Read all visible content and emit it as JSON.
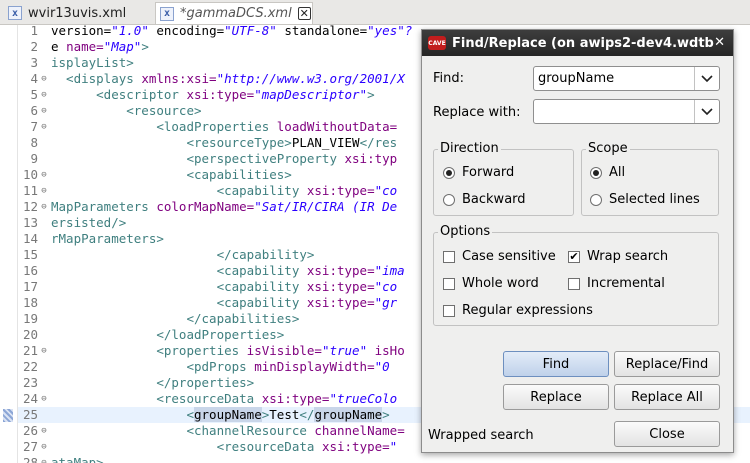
{
  "tabs": [
    {
      "icon": "x",
      "name": "wvir13uvis.xml",
      "dirty": false
    },
    {
      "icon": "x",
      "name": "*gammaDCS.xml",
      "dirty": true,
      "close": "☒"
    }
  ],
  "editor": {
    "lines": [
      {
        "num": "1",
        "fold": "",
        "parts": [
          [
            "tx",
            "version="
          ],
          [
            "av",
            "\"1.0\""
          ],
          [
            "tx",
            " encoding="
          ],
          [
            "av",
            "\"UTF-8\""
          ],
          [
            "tx",
            " standalone="
          ],
          [
            "av",
            "\"yes\"?"
          ]
        ]
      },
      {
        "num": "2",
        "fold": "",
        "parts": [
          [
            "tx",
            "e "
          ],
          [
            "at",
            "name="
          ],
          [
            "av",
            "\"Map\""
          ],
          [
            "tg",
            ">"
          ]
        ]
      },
      {
        "num": "3",
        "fold": "",
        "parts": [
          [
            "tg",
            "isplayList>"
          ]
        ]
      },
      {
        "num": "4",
        "fold": "⊖",
        "parts": [
          [
            "tg",
            "  <displays "
          ],
          [
            "at",
            "xmlns:xsi="
          ],
          [
            "av",
            "\"http://www.w3.org/2001/X"
          ]
        ]
      },
      {
        "num": "5",
        "fold": "⊖",
        "parts": [
          [
            "tg",
            "      <descriptor "
          ],
          [
            "at",
            "xsi:type="
          ],
          [
            "av",
            "\"mapDescriptor\""
          ],
          [
            "tg",
            ">"
          ]
        ]
      },
      {
        "num": "6",
        "fold": "⊖",
        "parts": [
          [
            "tg",
            "          <resource>"
          ]
        ]
      },
      {
        "num": "7",
        "fold": "⊖",
        "parts": [
          [
            "tg",
            "              <loadProperties "
          ],
          [
            "at",
            "loadWithoutData="
          ]
        ]
      },
      {
        "num": "8",
        "fold": "",
        "parts": [
          [
            "tg",
            "                  <resourceType>"
          ],
          [
            "tx",
            "PLAN_VIEW"
          ],
          [
            "tg",
            "</res"
          ]
        ]
      },
      {
        "num": "9",
        "fold": "",
        "parts": [
          [
            "tg",
            "                  <perspectiveProperty "
          ],
          [
            "at",
            "xsi:typ"
          ]
        ]
      },
      {
        "num": "10",
        "fold": "⊖",
        "parts": [
          [
            "tg",
            "                  <capabilities>"
          ]
        ]
      },
      {
        "num": "11",
        "fold": "⊖",
        "parts": [
          [
            "tg",
            "                      <capability "
          ],
          [
            "at",
            "xsi:type="
          ],
          [
            "av",
            "\"co"
          ]
        ]
      },
      {
        "num": "12",
        "fold": "⊖",
        "parts": [
          [
            "tg",
            "MapParameters "
          ],
          [
            "at",
            "colorMapName="
          ],
          [
            "av",
            "\"Sat/IR/CIRA (IR De"
          ]
        ]
      },
      {
        "num": "13",
        "fold": "",
        "parts": [
          [
            "tg",
            "ersisted/>"
          ]
        ]
      },
      {
        "num": "14",
        "fold": "",
        "parts": [
          [
            "tg",
            "rMapParameters>"
          ]
        ]
      },
      {
        "num": "15",
        "fold": "",
        "parts": [
          [
            "tg",
            "                      </capability>"
          ]
        ]
      },
      {
        "num": "16",
        "fold": "",
        "parts": [
          [
            "tg",
            "                      <capability "
          ],
          [
            "at",
            "xsi:type="
          ],
          [
            "av",
            "\"ima"
          ]
        ]
      },
      {
        "num": "17",
        "fold": "",
        "parts": [
          [
            "tg",
            "                      <capability "
          ],
          [
            "at",
            "xsi:type="
          ],
          [
            "av",
            "\"co"
          ]
        ]
      },
      {
        "num": "18",
        "fold": "",
        "parts": [
          [
            "tg",
            "                      <capability "
          ],
          [
            "at",
            "xsi:type="
          ],
          [
            "av",
            "\"gr"
          ]
        ]
      },
      {
        "num": "19",
        "fold": "",
        "parts": [
          [
            "tg",
            "                  </capabilities>"
          ]
        ]
      },
      {
        "num": "20",
        "fold": "",
        "parts": [
          [
            "tg",
            "              </loadProperties>"
          ]
        ]
      },
      {
        "num": "21",
        "fold": "⊖",
        "parts": [
          [
            "tg",
            "              <properties "
          ],
          [
            "at",
            "isVisible="
          ],
          [
            "av",
            "\"true\""
          ],
          [
            "at",
            " isHo"
          ]
        ]
      },
      {
        "num": "22",
        "fold": "",
        "parts": [
          [
            "tg",
            "                  <pdProps "
          ],
          [
            "at",
            "minDisplayWidth="
          ],
          [
            "av",
            "\"0"
          ]
        ]
      },
      {
        "num": "23",
        "fold": "",
        "parts": [
          [
            "tg",
            "              </properties>"
          ]
        ]
      },
      {
        "num": "24",
        "fold": "⊖",
        "parts": [
          [
            "tg",
            "              <resourceData "
          ],
          [
            "at",
            "xsi:type="
          ],
          [
            "av",
            "\"trueColo"
          ]
        ]
      },
      {
        "num": "25",
        "fold": "",
        "current": true,
        "parts": [
          [
            "tg",
            "                  <"
          ],
          [
            "hl",
            "groupName"
          ],
          [
            "tg",
            ">"
          ],
          [
            "tx",
            "Test"
          ],
          [
            "tg",
            "</"
          ],
          [
            "hl",
            "groupName"
          ],
          [
            "tg",
            ">"
          ]
        ]
      },
      {
        "num": "26",
        "fold": "⊖",
        "parts": [
          [
            "tg",
            "                  <channelResource "
          ],
          [
            "at",
            "channelName="
          ]
        ]
      },
      {
        "num": "27",
        "fold": "⊖",
        "parts": [
          [
            "tg",
            "                      <resourceData "
          ],
          [
            "at",
            "xsi:type="
          ],
          [
            "av",
            "\""
          ]
        ]
      },
      {
        "num": "28",
        "fold": "⊖",
        "parts": [
          [
            "tg",
            "ataMap>"
          ]
        ]
      }
    ]
  },
  "dialog": {
    "title": "Find/Replace  (on awips2-dev4.wdtb",
    "find_label": "Find:",
    "find_value": "groupName",
    "replace_label": "Replace with:",
    "replace_value": "",
    "direction_title": "Direction",
    "forward": "Forward",
    "backward": "Backward",
    "direction_selected": "Forward",
    "scope_title": "Scope",
    "all": "All",
    "selected_lines": "Selected lines",
    "scope_selected": "All",
    "options_title": "Options",
    "case_sensitive": {
      "label": "Case sensitive",
      "checked": false
    },
    "wrap_search": {
      "label": "Wrap search",
      "checked": true
    },
    "whole_word": {
      "label": "Whole word",
      "checked": false
    },
    "incremental": {
      "label": "Incremental",
      "checked": false
    },
    "regular_expressions": {
      "label": "Regular expressions",
      "checked": false
    },
    "find_button": "Find",
    "replace_find_button": "Replace/Find",
    "replace_button": "Replace",
    "replace_all_button": "Replace All",
    "close_button": "Close",
    "status": "Wrapped search"
  }
}
